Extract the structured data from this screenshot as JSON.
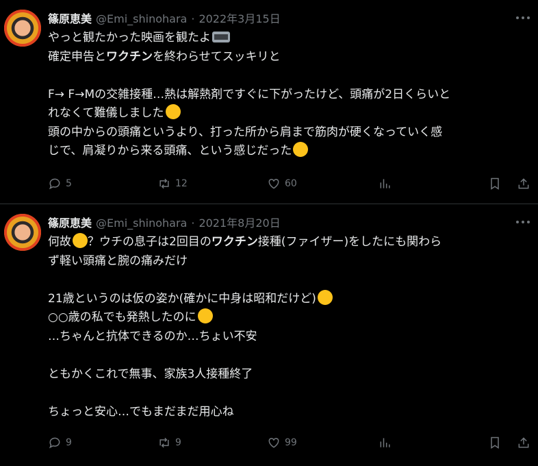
{
  "tweets": [
    {
      "name": "篠原恵美",
      "handle": "@Emi_shinohara",
      "separator": "·",
      "date": "2022年3月15日",
      "lines": [
        "やっと観たかった映画を観たよ",
        "確定申告と",
        "ワクチン",
        "を終わらせてスッキリと",
        "",
        "F→ F→Mの交雑接種…熱は解熱剤ですぐに下がったけど、頭痛が2日くらいと",
        "れなくて難儀しました",
        "頭の中からの頭痛というより、打った所から肩まで筋肉が硬くなっていく感",
        "じで、肩凝りから来る頭痛、という感じだった"
      ],
      "replies": "5",
      "retweets": "12",
      "likes": "60",
      "emojis": [
        "film-frames-emoji",
        "disappointed-face-emoji",
        "worried-face-emoji"
      ]
    },
    {
      "name": "篠原恵美",
      "handle": "@Emi_shinohara",
      "separator": "·",
      "date": "2021年8月20日",
      "lines": [
        "何故",
        "？ウチの息子は2回目の",
        "ワクチン",
        "接種(ファイザー)をしたにも関わら",
        "ず軽い頭痛と腕の痛みだけ",
        "",
        "21歳というのは仮の姿か(確かに中身は昭和だけど)",
        "○○歳の私でも発熱したのに",
        "…ちゃんと抗体できるのか…ちょい不安",
        "",
        "ともかくこれで無事、家族3人接種終了",
        "",
        "ちょっと安心…でもまだまだ用心ね"
      ],
      "replies": "9",
      "retweets": "9",
      "likes": "99",
      "emojis": [
        "hushed-face-emoji",
        "flushed-face-emoji",
        "face-with-rolling-eyes-emoji"
      ]
    }
  ]
}
